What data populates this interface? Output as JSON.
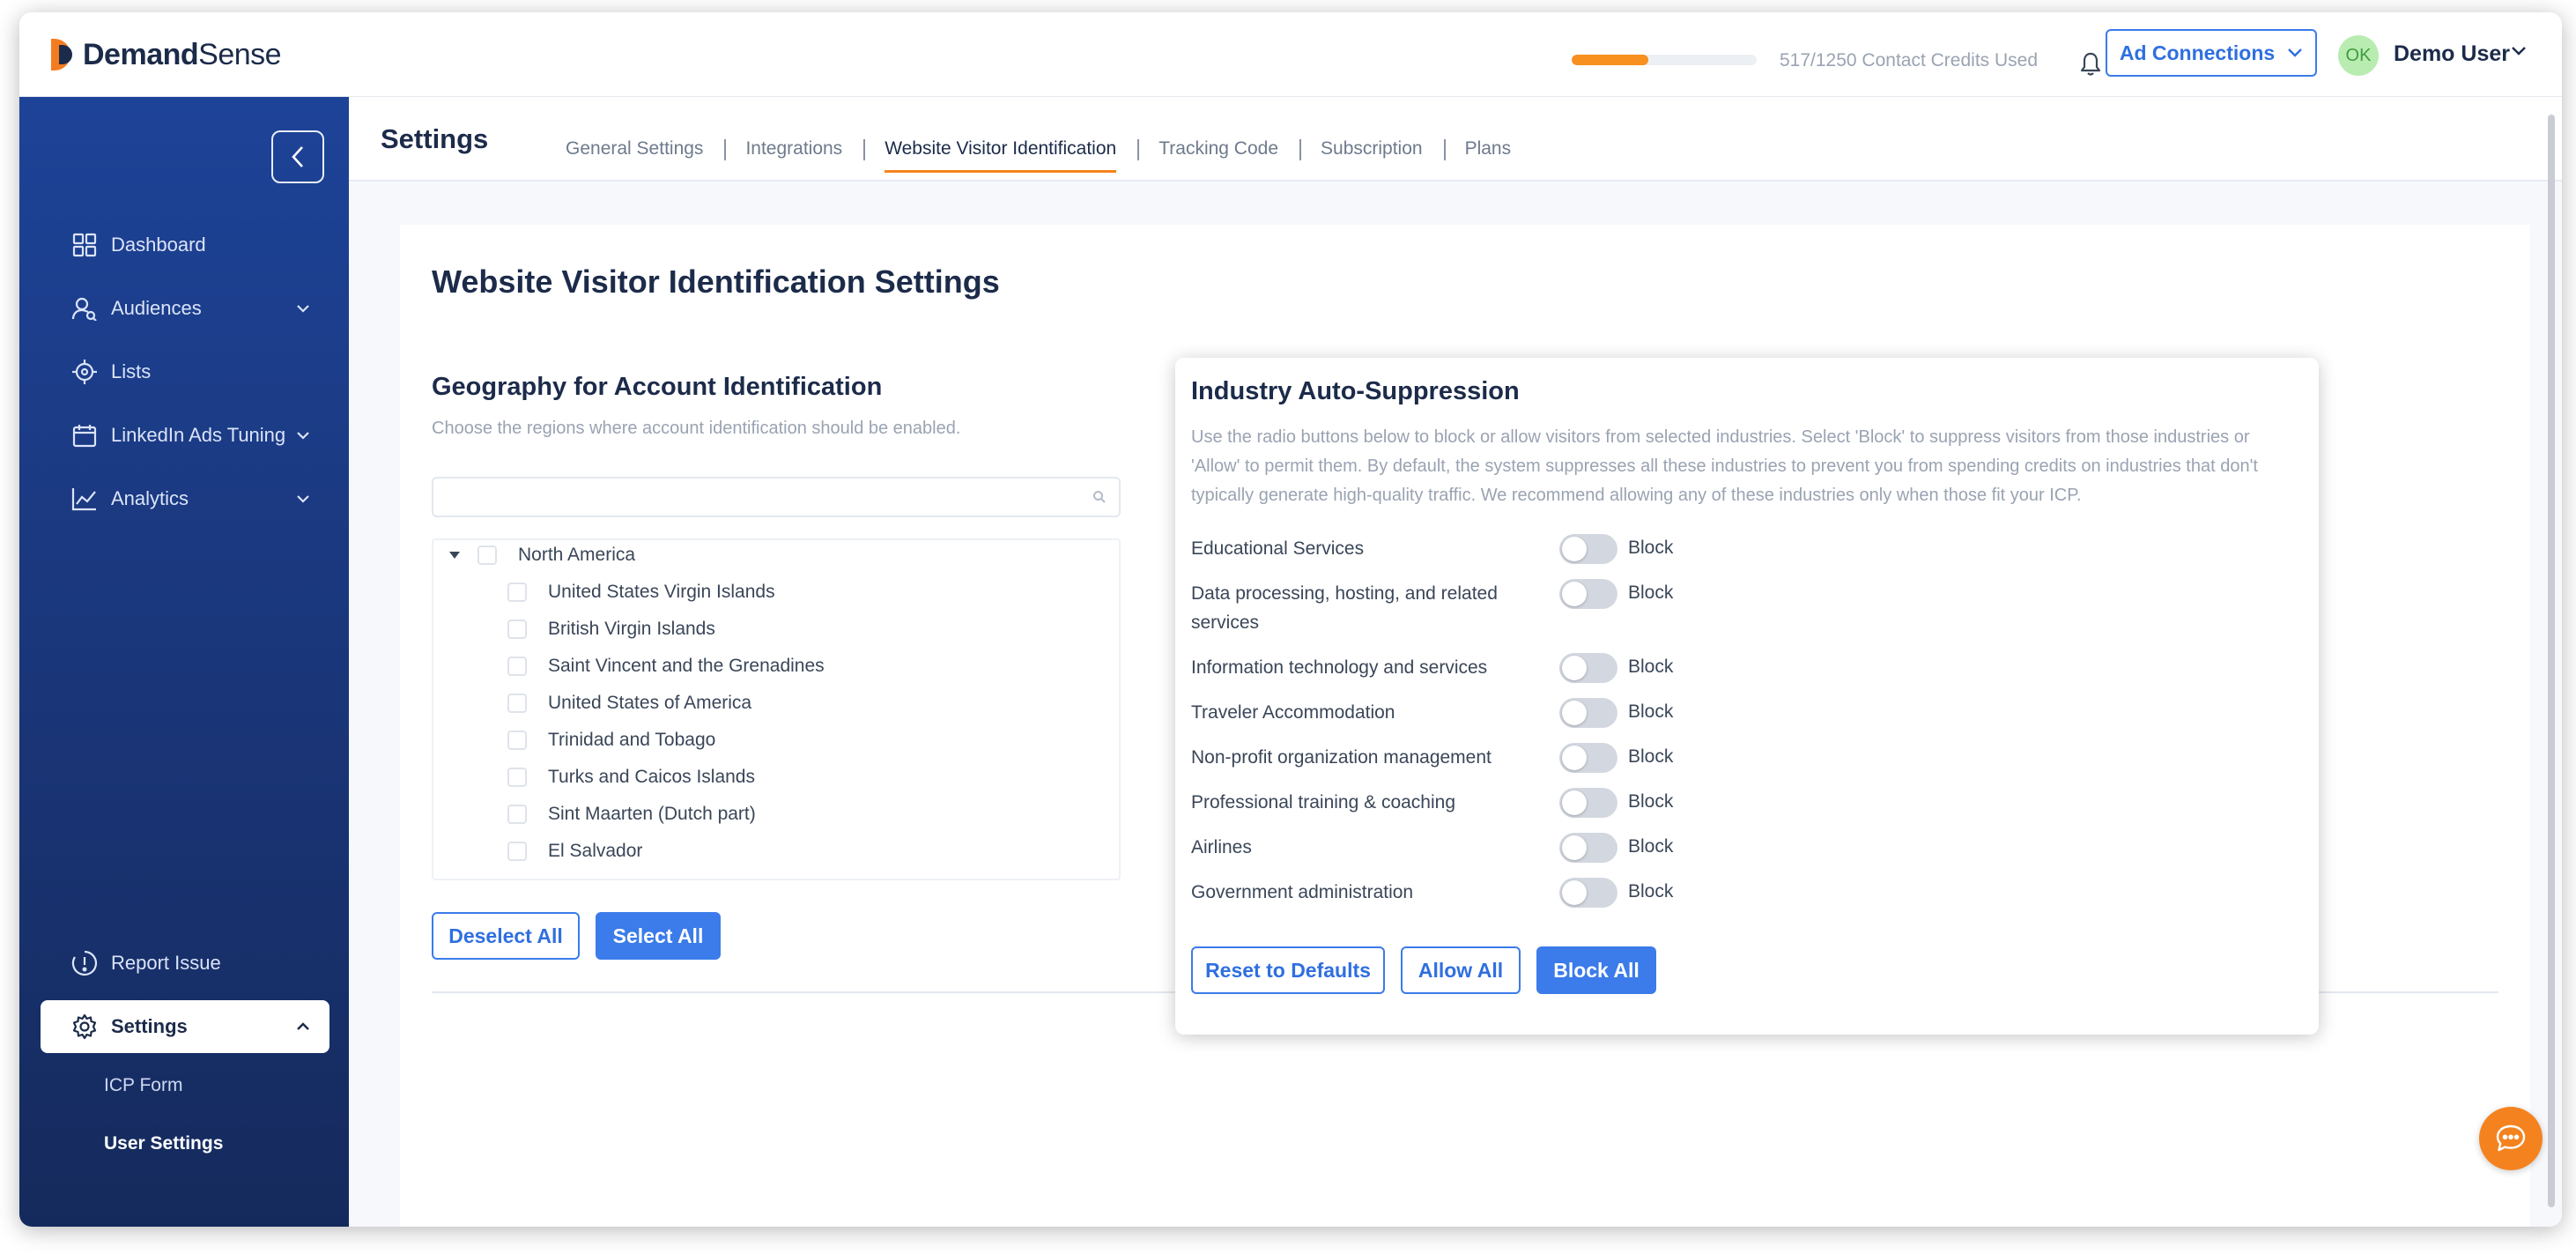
{
  "app": {
    "brand_bold": "Demand",
    "brand_light": "Sense"
  },
  "topbar": {
    "credits": {
      "used": 517,
      "total": 1250,
      "fraction": 0.4136,
      "text": "517/1250 Contact Credits Used"
    },
    "ad_connections_label": "Ad Connections",
    "avatar_initials": "OK",
    "user_name": "Demo User",
    "accent_color": "#f7901e",
    "primary_color": "#3b7bea"
  },
  "sidebar": {
    "items": [
      {
        "label": "Dashboard",
        "icon": "dashboard-grid-icon"
      },
      {
        "label": "Audiences",
        "icon": "audiences-icon",
        "expandable": true
      },
      {
        "label": "Lists",
        "icon": "target-icon"
      },
      {
        "label": "LinkedIn Ads Tuning",
        "icon": "calendar-icon",
        "expandable": true
      },
      {
        "label": "Analytics",
        "icon": "chart-line-icon",
        "expandable": true
      }
    ],
    "report_issue": "Report Issue",
    "settings": "Settings",
    "settings_children": [
      "ICP Form",
      "User Settings"
    ]
  },
  "main": {
    "page_title": "Settings",
    "tabs": [
      "General Settings",
      "Integrations",
      "Website Visitor Identification",
      "Tracking Code",
      "Subscription",
      "Plans"
    ],
    "active_tab": "Website Visitor Identification",
    "card_title": "Website Visitor Identification Settings"
  },
  "geography": {
    "title": "Geography for Account Identification",
    "description": "Choose the regions where account identification should be enabled.",
    "search_value": "",
    "region": "North America",
    "countries": [
      "United States Virgin Islands",
      "British Virgin Islands",
      "Saint Vincent and the Grenadines",
      "United States of America",
      "Trinidad and Tobago",
      "Turks and Caicos Islands",
      "Sint Maarten (Dutch part)",
      "El Salvador"
    ],
    "deselect_all": "Deselect All",
    "select_all": "Select All"
  },
  "suppression": {
    "title": "Industry Auto-Suppression",
    "description": "Use the radio buttons below to block or allow visitors from selected industries. Select 'Block' to suppress visitors from those industries or 'Allow' to permit them. By default, the system suppresses all these industries to prevent you from spending credits on industries that don't typically generate high-quality traffic. We recommend allowing any of these industries only when those fit your ICP.",
    "industries": [
      {
        "name": "Educational Services",
        "state": "Block"
      },
      {
        "name": "Data processing, hosting, and related services",
        "state": "Block"
      },
      {
        "name": "Information technology and services",
        "state": "Block"
      },
      {
        "name": "Traveler Accommodation",
        "state": "Block"
      },
      {
        "name": "Non-profit organization management",
        "state": "Block"
      },
      {
        "name": "Professional training & coaching",
        "state": "Block"
      },
      {
        "name": "Airlines",
        "state": "Block"
      },
      {
        "name": "Government administration",
        "state": "Block"
      }
    ],
    "reset_defaults": "Reset to Defaults",
    "allow_all": "Allow All",
    "block_all": "Block All"
  }
}
